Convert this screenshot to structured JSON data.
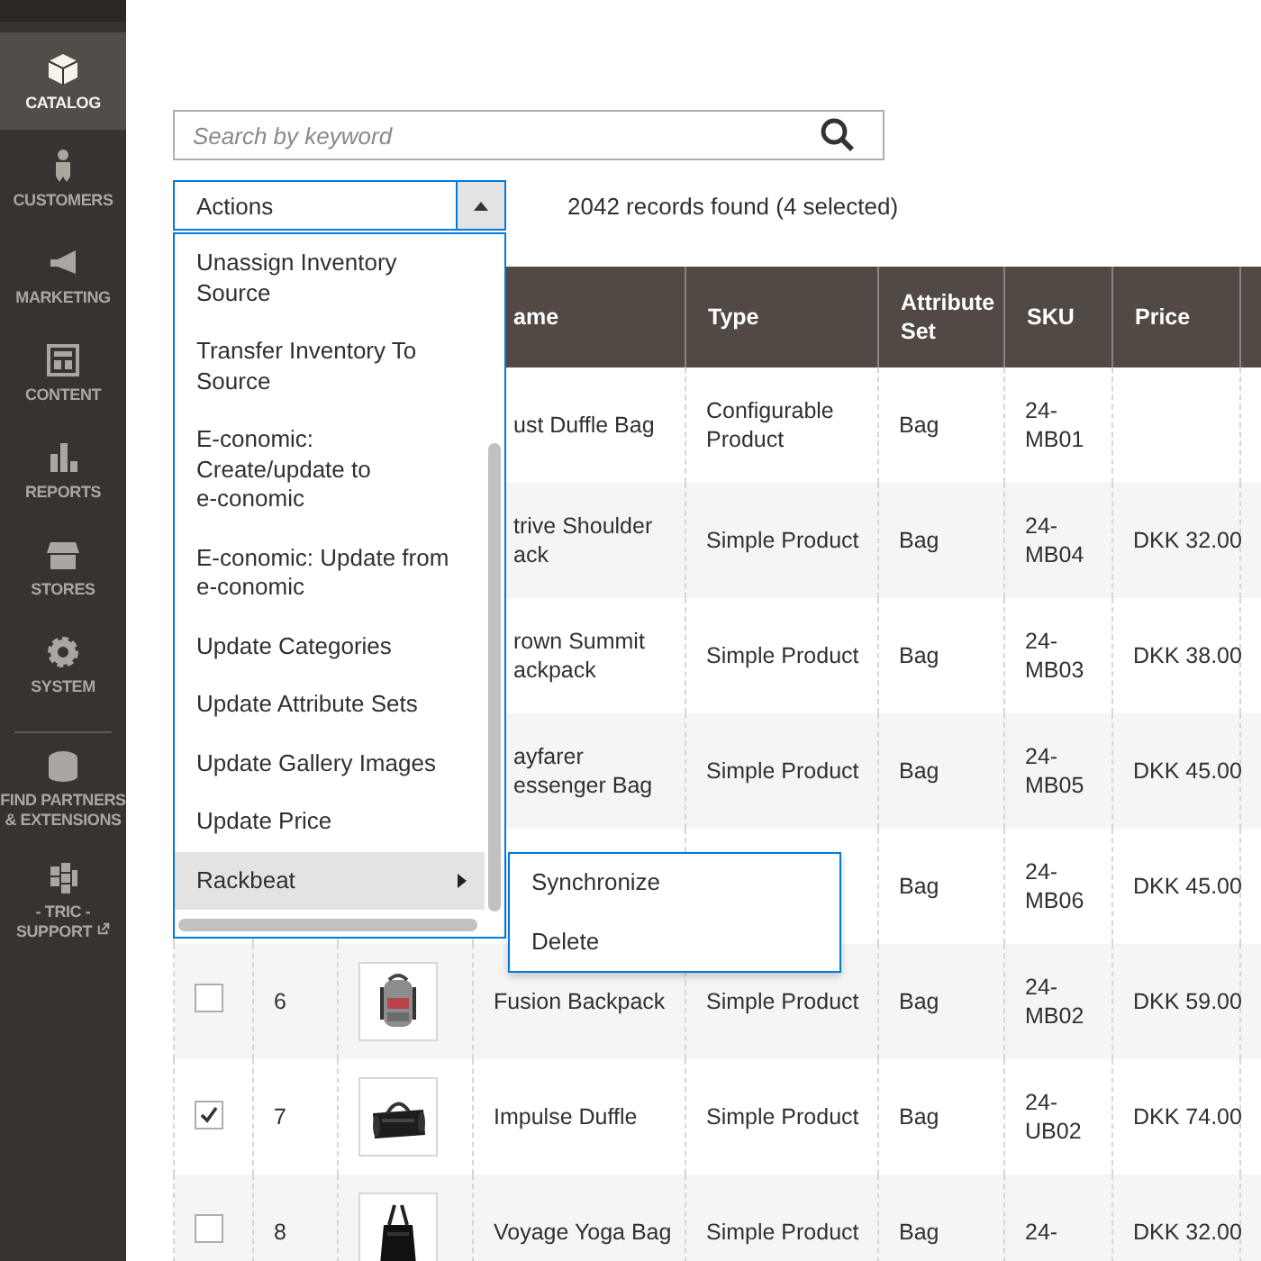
{
  "sidebar": {
    "items": [
      {
        "label": "CATALOG",
        "selected": true
      },
      {
        "label": "CUSTOMERS",
        "selected": false
      },
      {
        "label": "MARKETING",
        "selected": false
      },
      {
        "label": "CONTENT",
        "selected": false
      },
      {
        "label": "REPORTS",
        "selected": false
      },
      {
        "label": "STORES",
        "selected": false
      },
      {
        "label": "SYSTEM",
        "selected": false
      }
    ],
    "extra_items": [
      {
        "label": "FIND PARTNERS & EXTENSIONS",
        "external_link": false
      },
      {
        "label": "- TRIC - SUPPORT",
        "external_link": true
      }
    ]
  },
  "search": {
    "placeholder": "Search by keyword"
  },
  "actions": {
    "label": "Actions",
    "expanded": true,
    "items": [
      {
        "label": "Unassign Inventory\nSource",
        "has_submenu": false,
        "selected": false
      },
      {
        "label": "Transfer Inventory To\nSource",
        "has_submenu": false,
        "selected": false
      },
      {
        "label": "E-conomic:\nCreate/update to\ne-conomic",
        "has_submenu": false,
        "selected": false
      },
      {
        "label": "E-conomic: Update from\ne-conomic",
        "has_submenu": false,
        "selected": false
      },
      {
        "label": "Update Categories",
        "has_submenu": false,
        "selected": false
      },
      {
        "label": "Update Attribute Sets",
        "has_submenu": false,
        "selected": false
      },
      {
        "label": "Update Gallery Images",
        "has_submenu": false,
        "selected": false
      },
      {
        "label": "Update Price",
        "has_submenu": false,
        "selected": false
      },
      {
        "label": "Rackbeat",
        "has_submenu": true,
        "selected": true
      }
    ],
    "submenu": [
      "Synchronize",
      "Delete"
    ]
  },
  "records": "2042 records found (4 selected)",
  "table": {
    "columns": [
      "ame",
      "Type",
      "Attribute Set",
      "SKU",
      "Price"
    ],
    "rows": [
      {
        "name": "ust Duffle Bag",
        "type": "Configurable Product",
        "attribute_set": "Bag",
        "sku": "24-MB01"
      },
      {
        "name": "trive Shoulder ack",
        "type": "Simple Product",
        "attribute_set": "Bag",
        "sku": "24-MB04",
        "price": "DKK 32.00"
      },
      {
        "name": "rown Summit ackpack",
        "type": "Simple Product",
        "attribute_set": "Bag",
        "sku": "24-MB03",
        "price": "DKK 38.00"
      },
      {
        "name": "ayfarer essenger Bag",
        "type": "Simple Product",
        "attribute_set": "Bag",
        "sku": "24-MB05",
        "price": "DKK 45.00"
      },
      {
        "attribute_set": "Bag",
        "sku": "24-MB06",
        "price": "DKK 45.00"
      },
      {
        "selected": false,
        "id": "6",
        "name": "Fusion Backpack",
        "type": "Simple Product",
        "attribute_set": "Bag",
        "sku": "24-MB02",
        "price": "DKK 59.00"
      },
      {
        "selected": true,
        "id": "7",
        "name": "Impulse Duffle",
        "type": "Simple Product",
        "attribute_set": "Bag",
        "sku": "24-UB02",
        "price": "DKK 74.00"
      },
      {
        "selected": false,
        "id": "8",
        "name": "Voyage Yoga Bag",
        "type": "Simple Product",
        "attribute_set": "Bag",
        "sku": "24-",
        "price": "DKK 32.00"
      }
    ]
  }
}
